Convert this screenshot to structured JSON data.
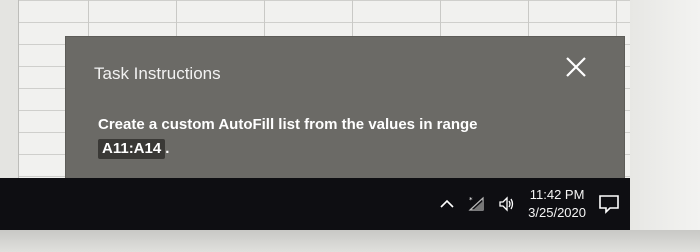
{
  "dialog": {
    "title": "Task Instructions",
    "body_text": "Create a custom AutoFill list from the values in range",
    "range": "A11:A14",
    "suffix": "."
  },
  "taskbar": {
    "time": "11:42 PM",
    "date": "3/25/2020",
    "tray_icons": [
      "chevron-up-icon",
      "wifi-icon",
      "volume-icon",
      "notification-icon"
    ]
  },
  "colors": {
    "dialog_bg": "#6b6a66",
    "taskbar_bg": "#0e0e12",
    "range_chip_bg": "#3a3936"
  }
}
